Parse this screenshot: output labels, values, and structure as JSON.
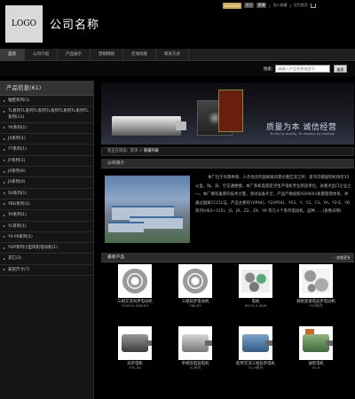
{
  "header": {
    "logo_text": "LOGO",
    "company_name": "公司名称",
    "language_button": "Goldsite",
    "top_links": [
      "首页",
      "繁體",
      "加入收藏",
      "设为首页"
    ],
    "cart_icon": "cart-icon"
  },
  "nav": {
    "items": [
      {
        "label": "首页",
        "active": true
      },
      {
        "label": "公司介绍",
        "active": false
      },
      {
        "label": "产品展示",
        "active": false
      },
      {
        "label": "营销网络",
        "active": false
      },
      {
        "label": "在线询盘",
        "active": false
      },
      {
        "label": "联系方式",
        "active": false
      }
    ]
  },
  "search": {
    "label": "搜索：",
    "placeholder": "请输入产品名称或型号",
    "button_label": "搜索"
  },
  "sidebar": {
    "title": "产品信息(61)",
    "items": [
      {
        "label": "轴密系列(1)"
      },
      {
        "label": "TL系列TL系列TL系列TL系列TL系列TL系列TL系列(11)"
      },
      {
        "label": "YK系列(1)"
      },
      {
        "label": "JX系列(1)"
      },
      {
        "label": "YT系列(1)"
      },
      {
        "label": "JY系列(1)"
      },
      {
        "label": "JX系列(6)"
      },
      {
        "label": "JS系列(6)"
      },
      {
        "label": "SS系列(1)"
      },
      {
        "label": "YBG系列(1)"
      },
      {
        "label": "YA系列(1)"
      },
      {
        "label": "YL系列(1)"
      },
      {
        "label": "YS-YK系列(1)"
      },
      {
        "label": "YGP系列小型风机电动机(1)"
      },
      {
        "label": "其它(2)"
      },
      {
        "label": "安装尺寸(7)"
      }
    ]
  },
  "banner": {
    "slogan": "质量为本  诚信经营",
    "subtitle": "To live by quality, To develop by prestige"
  },
  "breadcrumb": {
    "prefix": "您正在浏览：首页 > ",
    "current": "商铺列表"
  },
  "about": {
    "heading": "公司简介",
    "text": "本厂位于风景秀丽、人杰地灵的国家级风景名胜区滨江畔，紧邻京都国际机场仅35公里，陆、海、空交通便捷。本厂系机电部定点生产电机专业制造单位，省重点出口企业之一。本厂拥有雄厚的技术力量，测试设备齐全，产品严格按照ISO9001质量管理体系，并通过国家CCC认证，产品主要有Y(IP44)、Y2(IP54)、YX3、Y、Y2、Y3、YA、Y2-E、YB系列(H63~315)、JS、JR、Z2、Z4、YK 等几十个系列电动机，品种……(查看详情)"
  },
  "products": {
    "heading": "最新产品",
    "more_label": "查看更多",
    "items": [
      {
        "name": "三相交流同步电动机",
        "model": "YX5024-4KW-B3",
        "shape": "bearing"
      },
      {
        "name": "三相异步电动机",
        "model": "Y80-B3",
        "shape": "bearing"
      },
      {
        "name": "电机",
        "model": "JX07A-4-4KW",
        "shape": "multi"
      },
      {
        "name": "调频变速电异步电动机",
        "model": "YVS系列",
        "shape": "balls"
      },
      {
        "name": "异步电机",
        "model": "YYS-56",
        "shape": "motor-grey"
      },
      {
        "name": "单相双电容电机",
        "model": "YL系列",
        "shape": "motor"
      },
      {
        "name": "船用交流三相异步电机",
        "model": "Y2-H系列",
        "shape": "motor-blue"
      },
      {
        "name": "油泵电机",
        "model": "YS-H",
        "shape": "motor-green-red"
      }
    ]
  }
}
